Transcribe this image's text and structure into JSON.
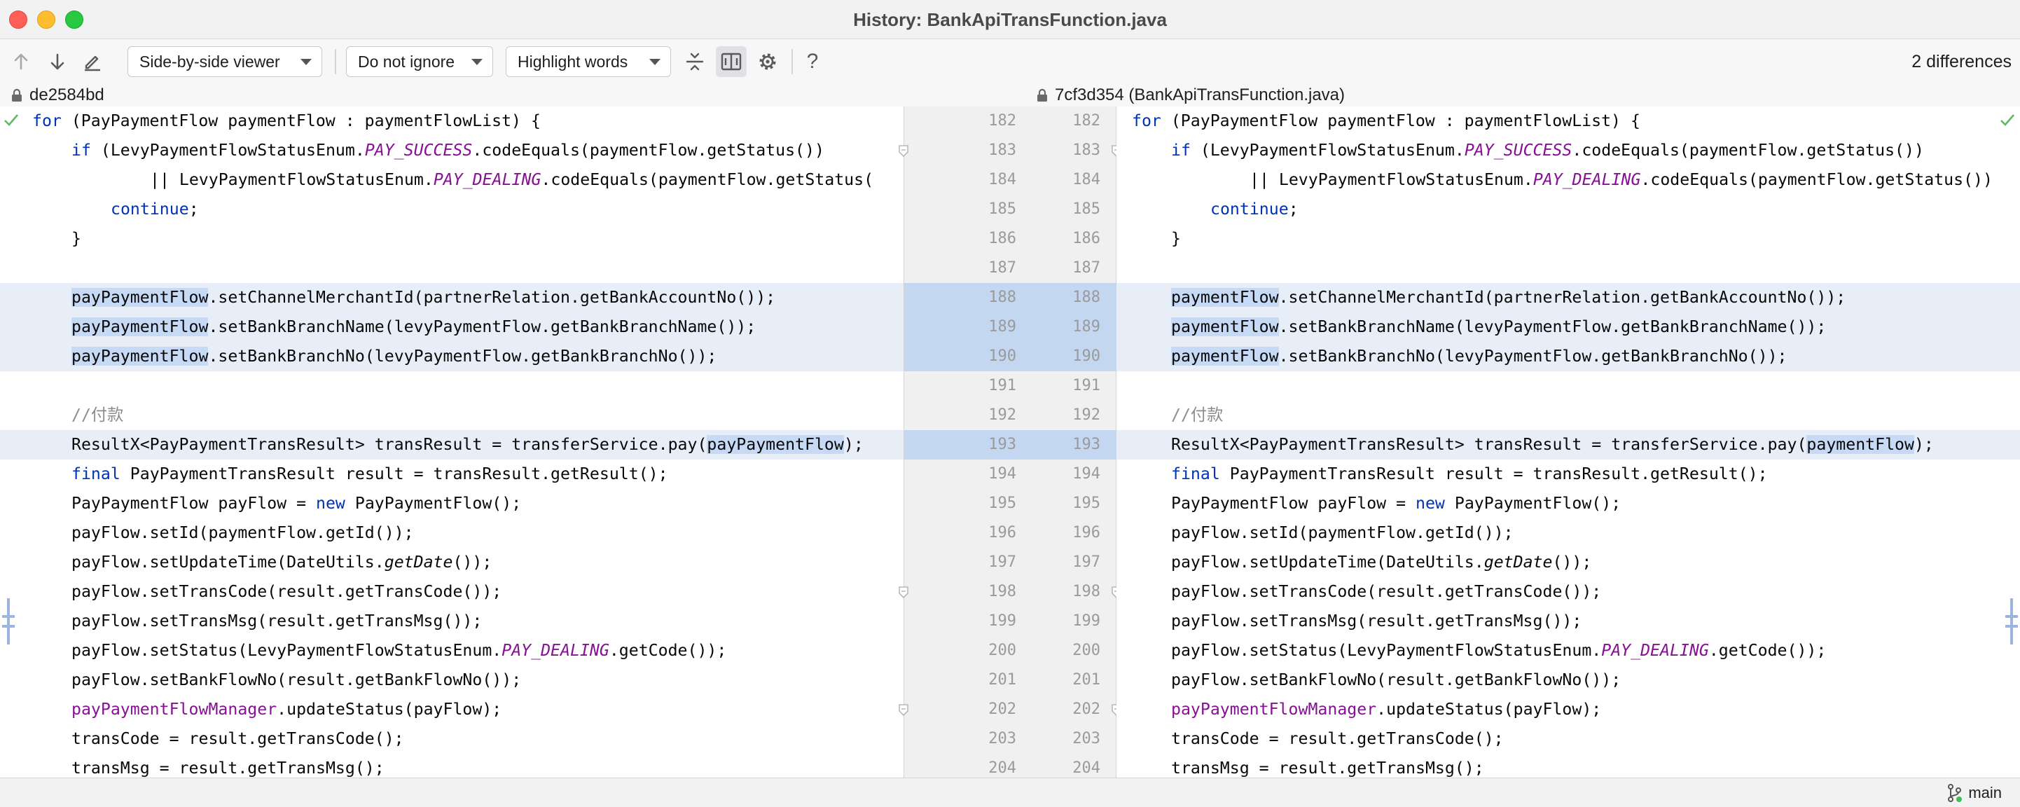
{
  "window": {
    "title": "History: BankApiTransFunction.java"
  },
  "toolbar": {
    "viewer": "Side-by-side viewer",
    "ignore": "Do not ignore",
    "highlight": "Highlight words",
    "help": "?",
    "differences": "2 differences"
  },
  "revisions": {
    "left": "de2584bd",
    "right": "7cf3d354 (BankApiTransFunction.java)"
  },
  "status": {
    "branch": "main"
  },
  "colors": {
    "modified_line": "#e8eef8",
    "word_highlight": "#c7daf5",
    "gutter_modified": "#c3d7f1",
    "keyword": "#0033b3",
    "constant": "#871094",
    "comment": "#8c8c8c"
  },
  "icons": [
    "lock-icon",
    "check-icon",
    "prev-diff-icon",
    "next-diff-icon",
    "edit-icon",
    "collapse-icon",
    "sync-scroll-icon",
    "gear-icon",
    "branch-icon"
  ],
  "diff": {
    "line_numbers": [
      "182",
      "183",
      "184",
      "185",
      "186",
      "187",
      "188",
      "189",
      "190",
      "191",
      "192",
      "193",
      "194",
      "195",
      "196",
      "197",
      "198",
      "199",
      "200",
      "201",
      "202",
      "203",
      "204"
    ],
    "modified_lines": [
      "188",
      "189",
      "190",
      "193"
    ],
    "left": [
      {
        "indent": 0,
        "segs": [
          {
            "k": "kw",
            "t": "for"
          },
          {
            "t": " (PayPaymentFlow paymentFlow : paymentFlowList) {"
          }
        ]
      },
      {
        "indent": 4,
        "segs": [
          {
            "k": "kw",
            "t": "if"
          },
          {
            "t": " (LevyPaymentFlowStatusEnum."
          },
          {
            "k": "cst",
            "t": "PAY_SUCCESS"
          },
          {
            "t": ".codeEquals(paymentFlow.getStatus())"
          }
        ]
      },
      {
        "indent": 12,
        "segs": [
          {
            "t": "|| LevyPaymentFlowStatusEnum."
          },
          {
            "k": "cst",
            "t": "PAY_DEALING"
          },
          {
            "t": ".codeEquals(paymentFlow.getStatus("
          }
        ]
      },
      {
        "indent": 8,
        "segs": [
          {
            "k": "kw",
            "t": "continue"
          },
          {
            "t": ";"
          }
        ]
      },
      {
        "indent": 4,
        "segs": [
          {
            "t": "}"
          }
        ]
      },
      {
        "indent": 0,
        "segs": []
      },
      {
        "indent": 4,
        "segs": [
          {
            "k": "hl",
            "t": "payPaymentFlow"
          },
          {
            "t": ".setChannelMerchantId(partnerRelation.getBankAccountNo());"
          }
        ]
      },
      {
        "indent": 4,
        "segs": [
          {
            "k": "hl",
            "t": "payPaymentFlow"
          },
          {
            "t": ".setBankBranchName(levyPaymentFlow.getBankBranchName());"
          }
        ]
      },
      {
        "indent": 4,
        "segs": [
          {
            "k": "hl",
            "t": "payPaymentFlow"
          },
          {
            "t": ".setBankBranchNo(levyPaymentFlow.getBankBranchNo());"
          }
        ]
      },
      {
        "indent": 0,
        "segs": []
      },
      {
        "indent": 4,
        "segs": [
          {
            "k": "cmt",
            "t": "//付款"
          }
        ]
      },
      {
        "indent": 4,
        "segs": [
          {
            "t": "ResultX<PayPaymentTransResult> transResult = transferService.pay("
          },
          {
            "k": "hl",
            "t": "payPaymentFlow"
          },
          {
            "t": ");"
          }
        ]
      },
      {
        "indent": 4,
        "segs": [
          {
            "k": "kw",
            "t": "final"
          },
          {
            "t": " PayPaymentTransResult result = transResult.getResult();"
          }
        ]
      },
      {
        "indent": 4,
        "segs": [
          {
            "t": "PayPaymentFlow payFlow = "
          },
          {
            "k": "kw",
            "t": "new"
          },
          {
            "t": " PayPaymentFlow();"
          }
        ]
      },
      {
        "indent": 4,
        "segs": [
          {
            "t": "payFlow.setId(paymentFlow.getId());"
          }
        ]
      },
      {
        "indent": 4,
        "segs": [
          {
            "t": "payFlow.setUpdateTime(DateUtils."
          },
          {
            "k": "itl",
            "t": "getDate"
          },
          {
            "t": "());"
          }
        ]
      },
      {
        "indent": 4,
        "segs": [
          {
            "t": "payFlow.setTransCode(result.getTransCode());"
          }
        ]
      },
      {
        "indent": 4,
        "segs": [
          {
            "t": "payFlow.setTransMsg(result.getTransMsg());"
          }
        ]
      },
      {
        "indent": 4,
        "segs": [
          {
            "t": "payFlow.setStatus(LevyPaymentFlowStatusEnum."
          },
          {
            "k": "cst",
            "t": "PAY_DEALING"
          },
          {
            "t": ".getCode());"
          }
        ]
      },
      {
        "indent": 4,
        "segs": [
          {
            "t": "payFlow.setBankFlowNo(result.getBankFlowNo());"
          }
        ]
      },
      {
        "indent": 4,
        "segs": [
          {
            "k": "fld",
            "t": "payPaymentFlowManager"
          },
          {
            "t": ".updateStatus(payFlow);"
          }
        ]
      },
      {
        "indent": 4,
        "segs": [
          {
            "t": "transCode = result.getTransCode();"
          }
        ]
      },
      {
        "indent": 4,
        "segs": [
          {
            "t": "transMsg = result.getTransMsg();"
          }
        ]
      }
    ],
    "right": [
      {
        "indent": 0,
        "segs": [
          {
            "k": "kw",
            "t": "for"
          },
          {
            "t": " (PayPaymentFlow paymentFlow : paymentFlowList) {"
          }
        ]
      },
      {
        "indent": 4,
        "segs": [
          {
            "k": "kw",
            "t": "if"
          },
          {
            "t": " (LevyPaymentFlowStatusEnum."
          },
          {
            "k": "cst",
            "t": "PAY_SUCCESS"
          },
          {
            "t": ".codeEquals(paymentFlow.getStatus())"
          }
        ]
      },
      {
        "indent": 12,
        "segs": [
          {
            "t": "|| LevyPaymentFlowStatusEnum."
          },
          {
            "k": "cst",
            "t": "PAY_DEALING"
          },
          {
            "t": ".codeEquals(paymentFlow.getStatus())"
          }
        ]
      },
      {
        "indent": 8,
        "segs": [
          {
            "k": "kw",
            "t": "continue"
          },
          {
            "t": ";"
          }
        ]
      },
      {
        "indent": 4,
        "segs": [
          {
            "t": "}"
          }
        ]
      },
      {
        "indent": 0,
        "segs": []
      },
      {
        "indent": 4,
        "segs": [
          {
            "k": "hl",
            "t": "paymentFlow"
          },
          {
            "t": ".setChannelMerchantId(partnerRelation.getBankAccountNo());"
          }
        ]
      },
      {
        "indent": 4,
        "segs": [
          {
            "k": "hl",
            "t": "paymentFlow"
          },
          {
            "t": ".setBankBranchName(levyPaymentFlow.getBankBranchName());"
          }
        ]
      },
      {
        "indent": 4,
        "segs": [
          {
            "k": "hl",
            "t": "paymentFlow"
          },
          {
            "t": ".setBankBranchNo(levyPaymentFlow.getBankBranchNo());"
          }
        ]
      },
      {
        "indent": 0,
        "segs": []
      },
      {
        "indent": 4,
        "segs": [
          {
            "k": "cmt",
            "t": "//付款"
          }
        ]
      },
      {
        "indent": 4,
        "segs": [
          {
            "t": "ResultX<PayPaymentTransResult> transResult = transferService.pay("
          },
          {
            "k": "hl",
            "t": "paymentFlow"
          },
          {
            "t": ");"
          }
        ]
      },
      {
        "indent": 4,
        "segs": [
          {
            "k": "kw",
            "t": "final"
          },
          {
            "t": " PayPaymentTransResult result = transResult.getResult();"
          }
        ]
      },
      {
        "indent": 4,
        "segs": [
          {
            "t": "PayPaymentFlow payFlow = "
          },
          {
            "k": "kw",
            "t": "new"
          },
          {
            "t": " PayPaymentFlow();"
          }
        ]
      },
      {
        "indent": 4,
        "segs": [
          {
            "t": "payFlow.setId(paymentFlow.getId());"
          }
        ]
      },
      {
        "indent": 4,
        "segs": [
          {
            "t": "payFlow.setUpdateTime(DateUtils."
          },
          {
            "k": "itl",
            "t": "getDate"
          },
          {
            "t": "());"
          }
        ]
      },
      {
        "indent": 4,
        "segs": [
          {
            "t": "payFlow.setTransCode(result.getTransCode());"
          }
        ]
      },
      {
        "indent": 4,
        "segs": [
          {
            "t": "payFlow.setTransMsg(result.getTransMsg());"
          }
        ]
      },
      {
        "indent": 4,
        "segs": [
          {
            "t": "payFlow.setStatus(LevyPaymentFlowStatusEnum."
          },
          {
            "k": "cst",
            "t": "PAY_DEALING"
          },
          {
            "t": ".getCode());"
          }
        ]
      },
      {
        "indent": 4,
        "segs": [
          {
            "t": "payFlow.setBankFlowNo(result.getBankFlowNo());"
          }
        ]
      },
      {
        "indent": 4,
        "segs": [
          {
            "k": "fld",
            "t": "payPaymentFlowManager"
          },
          {
            "t": ".updateStatus(payFlow);"
          }
        ]
      },
      {
        "indent": 4,
        "segs": [
          {
            "t": "transCode = result.getTransCode();"
          }
        ]
      },
      {
        "indent": 4,
        "segs": [
          {
            "t": "transMsg = result.getTransMsg();"
          }
        ]
      }
    ]
  }
}
